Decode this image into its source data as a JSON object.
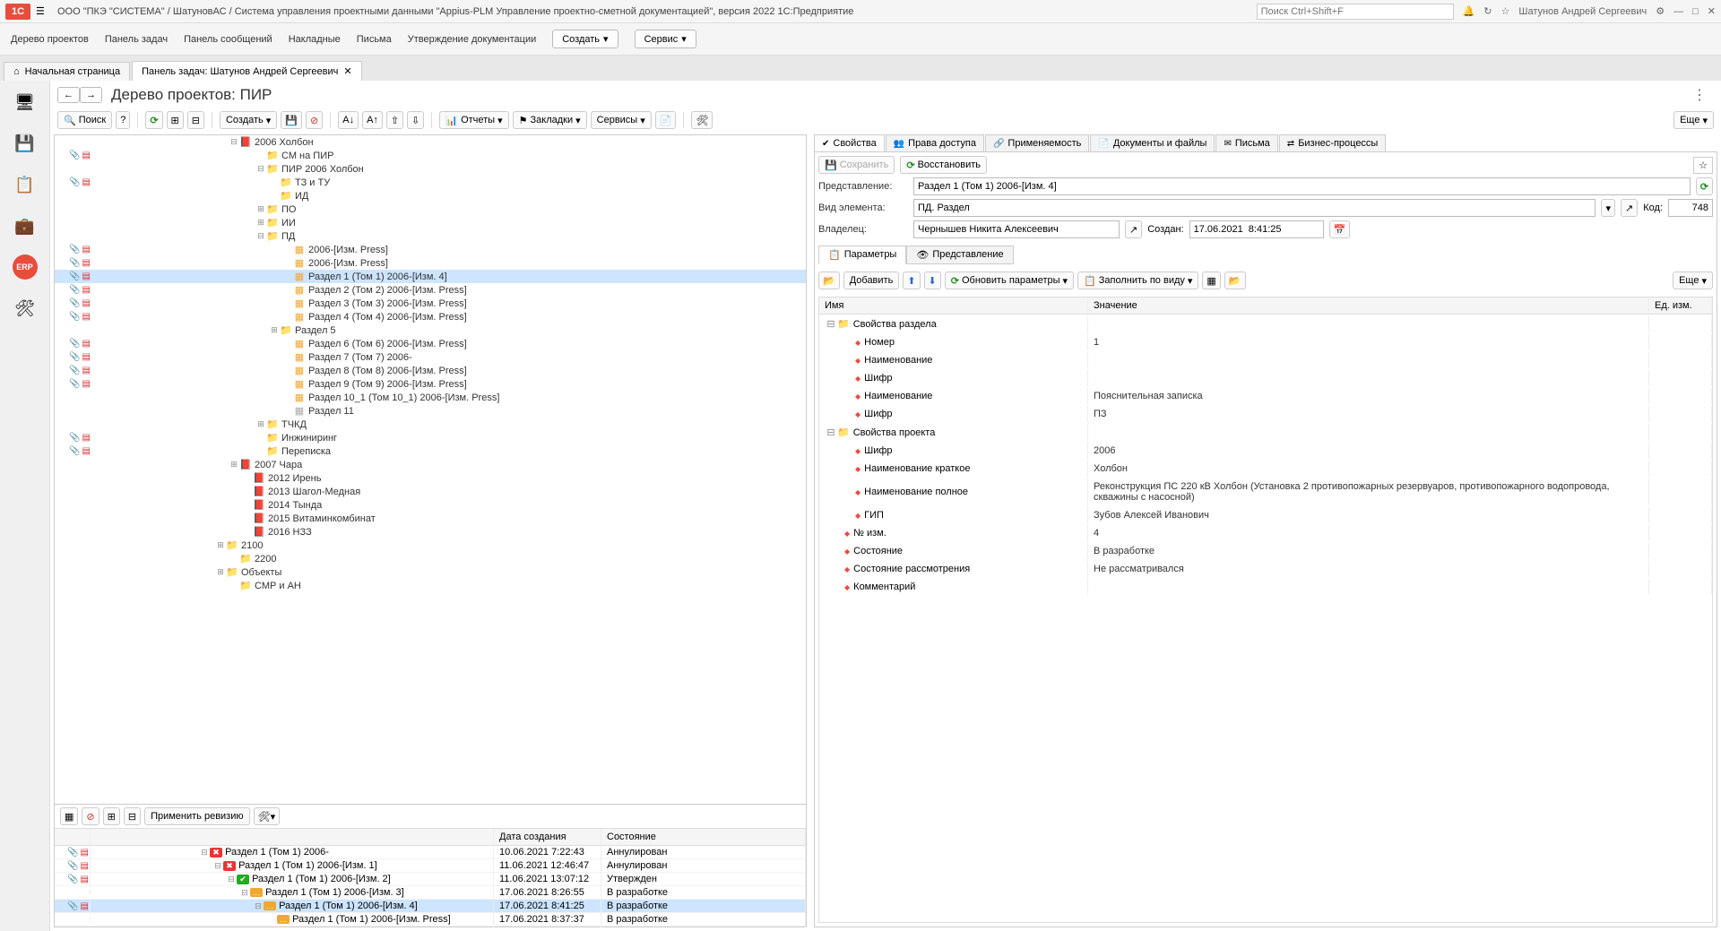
{
  "titlebar": {
    "logo": "1C",
    "text": "ООО \"ПКЭ \"СИСТЕМА\" / ШатуновАС / Система управления проектными данными \"Appius-PLM Управление проектно-сметной документацией\", версия 2022 1С:Предприятие",
    "search_placeholder": "Поиск Ctrl+Shift+F",
    "user": "Шатунов Андрей Сергеевич"
  },
  "mainmenu": {
    "items": [
      "Дерево проектов",
      "Панель задач",
      "Панель сообщений",
      "Накладные",
      "Письма",
      "Утверждение документации"
    ],
    "create": "Создать",
    "service": "Сервис"
  },
  "pagetabs": {
    "t0": "Начальная страница",
    "t1": "Панель задач: Шатунов Андрей Сергеевич"
  },
  "page": {
    "title": "Дерево проектов: ПИР"
  },
  "toolbar": {
    "search": "Поиск",
    "create": "Создать",
    "reports": "Отчеты",
    "bookmarks": "Закладки",
    "services": "Сервисы",
    "more": "Еще"
  },
  "tree": {
    "n0": {
      "pad": 150,
      "exp": "⊟",
      "ico": "📕",
      "cls": "ico-brief",
      "label": "2006 Холбон"
    },
    "n1": {
      "pad": 180,
      "exp": "",
      "ico": "📁",
      "cls": "ico-folder",
      "label": "СМ на ПИР",
      "pdf": true
    },
    "n2": {
      "pad": 180,
      "exp": "⊟",
      "ico": "📁",
      "cls": "ico-folder",
      "label": "ПИР 2006 Холбон"
    },
    "n3": {
      "pad": 195,
      "exp": "",
      "ico": "📁",
      "cls": "ico-folder",
      "label": "ТЗ и ТУ",
      "pdf": true
    },
    "n4": {
      "pad": 195,
      "exp": "",
      "ico": "📁",
      "cls": "ico-folder",
      "label": "ИД"
    },
    "n5": {
      "pad": 180,
      "exp": "⊞",
      "ico": "📁",
      "cls": "ico-folder",
      "label": "ПО"
    },
    "n6": {
      "pad": 180,
      "exp": "⊞",
      "ico": "📁",
      "cls": "ico-folder",
      "label": "ИИ"
    },
    "n7": {
      "pad": 180,
      "exp": "⊟",
      "ico": "📁",
      "cls": "ico-folder",
      "label": "ПД"
    },
    "n8": {
      "pad": 210,
      "exp": "",
      "ico": "▦",
      "cls": "ico-doc",
      "label": "2006-[Изм. Press]",
      "pdf": true
    },
    "n9": {
      "pad": 210,
      "exp": "",
      "ico": "▦",
      "cls": "ico-doc",
      "label": "2006-[Изм. Press]",
      "pdf": true
    },
    "n10": {
      "pad": 210,
      "exp": "",
      "ico": "▦",
      "cls": "ico-doc",
      "label": "Раздел 1 (Том 1) 2006-[Изм. 4]",
      "pdf": true,
      "selected": true
    },
    "n11": {
      "pad": 210,
      "exp": "",
      "ico": "▦",
      "cls": "ico-doc",
      "label": "Раздел 2 (Том 2) 2006-[Изм. Press]",
      "pdf": true
    },
    "n12": {
      "pad": 210,
      "exp": "",
      "ico": "▦",
      "cls": "ico-doc",
      "label": "Раздел 3 (Том 3) 2006-[Изм. Press]",
      "pdf": true
    },
    "n13": {
      "pad": 210,
      "exp": "",
      "ico": "▦",
      "cls": "ico-doc",
      "label": "Раздел 4 (Том 4) 2006-[Изм. Press]",
      "pdf": true
    },
    "n14": {
      "pad": 195,
      "exp": "⊞",
      "ico": "📁",
      "cls": "ico-folder",
      "label": "Раздел 5"
    },
    "n15": {
      "pad": 210,
      "exp": "",
      "ico": "▦",
      "cls": "ico-doc",
      "label": "Раздел 6 (Том 6) 2006-[Изм. Press]",
      "pdf": true
    },
    "n16": {
      "pad": 210,
      "exp": "",
      "ico": "▦",
      "cls": "ico-doc",
      "label": "Раздел 7 (Том 7) 2006-",
      "pdf": true
    },
    "n17": {
      "pad": 210,
      "exp": "",
      "ico": "▦",
      "cls": "ico-doc",
      "label": "Раздел 8 (Том 8) 2006-[Изм. Press]",
      "pdf": true
    },
    "n18": {
      "pad": 210,
      "exp": "",
      "ico": "▦",
      "cls": "ico-doc",
      "label": "Раздел 9 (Том 9) 2006-[Изм. Press]",
      "pdf": true
    },
    "n19": {
      "pad": 210,
      "exp": "",
      "ico": "▦",
      "cls": "ico-doc",
      "label": "Раздел 10_1 (Том 10_1) 2006-[Изм. Press]"
    },
    "n20": {
      "pad": 210,
      "exp": "",
      "ico": "▦",
      "cls": "ico-doc-grey",
      "label": "Раздел 11"
    },
    "n21": {
      "pad": 180,
      "exp": "⊞",
      "ico": "📁",
      "cls": "ico-folder",
      "label": "ТЧКД"
    },
    "n22": {
      "pad": 180,
      "exp": "",
      "ico": "📁",
      "cls": "ico-folder",
      "label": "Инжиниринг",
      "pdf": true
    },
    "n23": {
      "pad": 180,
      "exp": "",
      "ico": "📁",
      "cls": "ico-folder",
      "label": "Переписка",
      "pdf": true
    },
    "n24": {
      "pad": 150,
      "exp": "⊞",
      "ico": "📕",
      "cls": "ico-brief",
      "label": "2007 Чара"
    },
    "n25": {
      "pad": 165,
      "exp": "",
      "ico": "📕",
      "cls": "ico-brief",
      "label": "2012 Ирень"
    },
    "n26": {
      "pad": 165,
      "exp": "",
      "ico": "📕",
      "cls": "ico-brief",
      "label": "2013 Шагол-Медная"
    },
    "n27": {
      "pad": 165,
      "exp": "",
      "ico": "📕",
      "cls": "ico-brief",
      "label": "2014 Тында"
    },
    "n28": {
      "pad": 165,
      "exp": "",
      "ico": "📕",
      "cls": "ico-brief",
      "label": "2015 Витаминкомбинат"
    },
    "n29": {
      "pad": 165,
      "exp": "",
      "ico": "📕",
      "cls": "ico-brief",
      "label": "2016 НЗЗ"
    },
    "n30": {
      "pad": 135,
      "exp": "⊞",
      "ico": "📁",
      "cls": "ico-folder",
      "label": "2100"
    },
    "n31": {
      "pad": 150,
      "exp": "",
      "ico": "📁",
      "cls": "ico-folder",
      "label": "2200"
    },
    "n32": {
      "pad": 135,
      "exp": "⊞",
      "ico": "📁",
      "cls": "ico-folder",
      "label": "Объекты"
    },
    "n33": {
      "pad": 150,
      "exp": "",
      "ico": "📁",
      "cls": "ico-folder",
      "label": "СМР и АН"
    }
  },
  "bottom": {
    "apply_revision": "Применить ревизию",
    "head": {
      "c2": "",
      "c3": "Дата создания",
      "c4": "Состояние"
    },
    "rows": [
      {
        "pad": 115,
        "exp": "⊟",
        "stat": "✖",
        "scls": "stat-red",
        "label": "Раздел 1 (Том 1) 2006-",
        "date": "10.06.2021 7:22:43",
        "state": "Аннулирован",
        "pdf": true
      },
      {
        "pad": 130,
        "exp": "⊟",
        "stat": "✖",
        "scls": "stat-red",
        "label": "Раздел 1 (Том 1) 2006-[Изм. 1]",
        "date": "11.06.2021 12:46:47",
        "state": "Аннулирован",
        "pdf": true
      },
      {
        "pad": 145,
        "exp": "⊟",
        "stat": "✔",
        "scls": "stat-green",
        "label": "Раздел 1 (Том 1) 2006-[Изм. 2]",
        "date": "11.06.2021 13:07:12",
        "state": "Утвержден",
        "pdf": true
      },
      {
        "pad": 160,
        "exp": "⊟",
        "stat": "…",
        "scls": "stat-yel",
        "label": "Раздел 1 (Том 1) 2006-[Изм. 3]",
        "date": "17.06.2021 8:26:55",
        "state": "В разработке",
        "pdf": false
      },
      {
        "pad": 175,
        "exp": "⊟",
        "stat": "…",
        "scls": "stat-yel",
        "label": "Раздел 1 (Том 1) 2006-[Изм. 4]",
        "date": "17.06.2021 8:41:25",
        "state": "В разработке",
        "pdf": true,
        "selected": true
      },
      {
        "pad": 190,
        "exp": "",
        "stat": "…",
        "scls": "stat-yel",
        "label": "Раздел 1 (Том 1) 2006-[Изм. Press]",
        "date": "17.06.2021 8:37:37",
        "state": "В разработке",
        "pdf": false
      }
    ]
  },
  "rtabs": {
    "t0": "Свойства",
    "t1": "Права доступа",
    "t2": "Применяемость",
    "t3": "Документы и файлы",
    "t4": "Письма",
    "t5": "Бизнес-процессы"
  },
  "props": {
    "save": "Сохранить",
    "restore": "Восстановить",
    "repr_label": "Представление:",
    "repr": "Раздел 1 (Том 1) 2006-[Изм. 4]",
    "kind_label": "Вид элемента:",
    "kind": "ПД. Раздел",
    "code_label": "Код:",
    "code": "748",
    "owner_label": "Владелец:",
    "owner": "Чернышев Никита Алексеевич",
    "created_label": "Создан:",
    "created": "17.06.2021  8:41:25",
    "subtab0": "Параметры",
    "subtab1": "Представление",
    "add": "Добавить",
    "refresh_params": "Обновить параметры",
    "fill_by_kind": "Заполнить по виду",
    "more": "Еще",
    "head": {
      "name": "Имя",
      "value": "Значение",
      "uom": "Ед. изм."
    },
    "g1": "Свойства раздела",
    "p_num": "Номер",
    "v_num": "1",
    "p_name1": "Наименование",
    "v_name1": "",
    "p_shifr1": "Шифр",
    "v_shifr1": "",
    "p_name2": "Наименование",
    "v_name2": "Пояснительная записка",
    "p_shifr2": "Шифр",
    "v_shifr2": "ПЗ",
    "g2": "Свойства проекта",
    "p_shifr3": "Шифр",
    "v_shifr3": "2006",
    "p_short": "Наименование краткое",
    "v_short": "Холбон",
    "p_full": "Наименование полное",
    "v_full": "Реконструкция ПС 220 кВ Холбон (Установка 2 противопожарных резервуаров, противопожарного водопровода, скважины с насосной)",
    "p_gip": "ГИП",
    "v_gip": "Зубов Алексей Иванович",
    "p_nizm": "№ изм.",
    "v_nizm": "4",
    "p_state": "Состояние",
    "v_state": "В разработке",
    "p_review": "Состояние рассмотрения",
    "v_review": "Не рассматривался",
    "p_comment": "Комментарий",
    "v_comment": ""
  }
}
